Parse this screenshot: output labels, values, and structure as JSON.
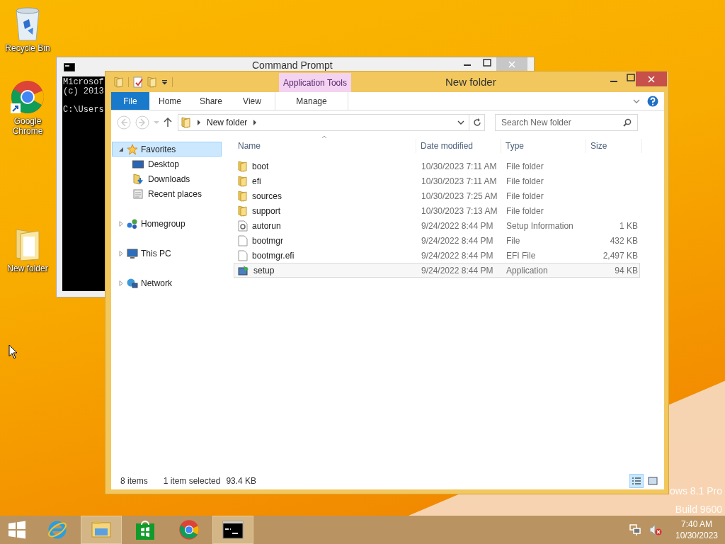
{
  "desktop_icons": [
    {
      "label": "Recycle Bin",
      "kind": "recycle"
    },
    {
      "label": "Google Chrome",
      "kind": "chrome"
    },
    {
      "label": "New folder",
      "kind": "folder"
    }
  ],
  "os_badge": [
    "ows 8.1 Pro",
    "Build 9600"
  ],
  "cmd_window": {
    "title": "Command Prompt",
    "header_lines": [
      "Microsof",
      "(c) 2013"
    ],
    "prompt": "C:\\Users"
  },
  "explorer": {
    "title": "New folder",
    "contextual_group": "Application Tools",
    "ribbon_tabs": [
      {
        "label": "File",
        "kind": "file"
      },
      {
        "label": "Home",
        "kind": "tab"
      },
      {
        "label": "Share",
        "kind": "tab"
      },
      {
        "label": "View",
        "kind": "tab"
      },
      {
        "label": "Manage",
        "kind": "contextual"
      }
    ],
    "address": {
      "path": [
        "New folder"
      ]
    },
    "search": {
      "placeholder": "Search New folder"
    },
    "nav": [
      {
        "label": "Favorites",
        "kind": "favorites",
        "expanded": true,
        "selected": true,
        "children": [
          {
            "label": "Desktop",
            "kind": "desktop",
            "selected": false
          },
          {
            "label": "Downloads",
            "kind": "downloads",
            "selected": false
          },
          {
            "label": "Recent places",
            "kind": "recent",
            "selected": false
          }
        ]
      },
      {
        "label": "Homegroup",
        "kind": "homegroup",
        "expanded": false,
        "selected": false
      },
      {
        "label": "This PC",
        "kind": "pc",
        "expanded": false,
        "selected": false
      },
      {
        "label": "Network",
        "kind": "network",
        "expanded": false,
        "selected": false
      }
    ],
    "columns": [
      "Name",
      "Date modified",
      "Type",
      "Size"
    ],
    "files": [
      {
        "name": "boot",
        "date": "10/30/2023 7:11 AM",
        "type": "File folder",
        "kind": "folder",
        "selected": false
      },
      {
        "name": "efi",
        "date": "10/30/2023 7:11 AM",
        "type": "File folder",
        "kind": "folder",
        "selected": false
      },
      {
        "name": "sources",
        "date": "10/30/2023 7:25 AM",
        "type": "File folder",
        "kind": "folder",
        "selected": false
      },
      {
        "name": "support",
        "date": "10/30/2023 7:13 AM",
        "type": "File folder",
        "kind": "folder",
        "selected": false
      },
      {
        "name": "autorun",
        "date": "9/24/2022 8:44 PM",
        "type": "Setup Information",
        "size": "1 KB",
        "kind": "settings",
        "selected": false
      },
      {
        "name": "bootmgr",
        "date": "9/24/2022 8:44 PM",
        "type": "File",
        "size": "432 KB",
        "kind": "file",
        "selected": false
      },
      {
        "name": "bootmgr.efi",
        "date": "9/24/2022 8:44 PM",
        "type": "EFI File",
        "size": "2,497 KB",
        "kind": "file",
        "selected": false
      },
      {
        "name": "setup",
        "date": "9/24/2022 8:44 PM",
        "type": "Application",
        "size": "94 KB",
        "kind": "app",
        "selected": true
      }
    ],
    "status": {
      "count": "8 items",
      "selection": "1 item selected",
      "selection_size": "93.4 KB"
    },
    "view_buttons": [
      {
        "kind": "details",
        "selected": true
      },
      {
        "kind": "large",
        "selected": false
      }
    ]
  },
  "taskbar": {
    "items": [
      {
        "kind": "start",
        "active": false
      },
      {
        "kind": "ie",
        "active": false
      },
      {
        "kind": "explorer",
        "active": true
      },
      {
        "kind": "store",
        "active": false
      },
      {
        "kind": "chrome",
        "active": false
      },
      {
        "kind": "cmd",
        "active": true
      }
    ]
  },
  "tray": {
    "volume_muted": true,
    "time": "7:40 AM",
    "date": "10/30/2023"
  }
}
